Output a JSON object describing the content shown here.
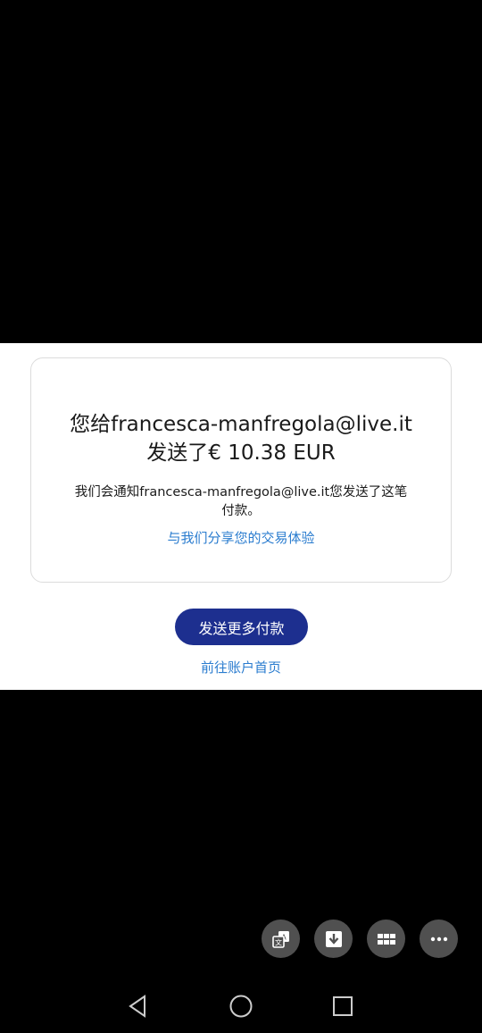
{
  "confirmation": {
    "headline_line1": "您给francesca-manfregola@live.it",
    "headline_line2": "发送了€ 10.38 EUR",
    "notice": "我们会通知francesca-manfregola@live.it您发送了这笔付款。",
    "share_link": "与我们分享您的交易体验"
  },
  "actions": {
    "send_more_label": "发送更多付款",
    "home_link": "前往账户首页"
  },
  "floating_buttons": [
    {
      "icon": "translate-icon"
    },
    {
      "icon": "download-icon"
    },
    {
      "icon": "apps-grid-icon"
    },
    {
      "icon": "more-horizontal-icon"
    }
  ],
  "system_nav": [
    {
      "icon": "back-icon"
    },
    {
      "icon": "home-icon"
    },
    {
      "icon": "recents-icon"
    }
  ],
  "colors": {
    "primary_button": "#1d2f8f",
    "link": "#2a7ccf",
    "fab": "#505050"
  }
}
